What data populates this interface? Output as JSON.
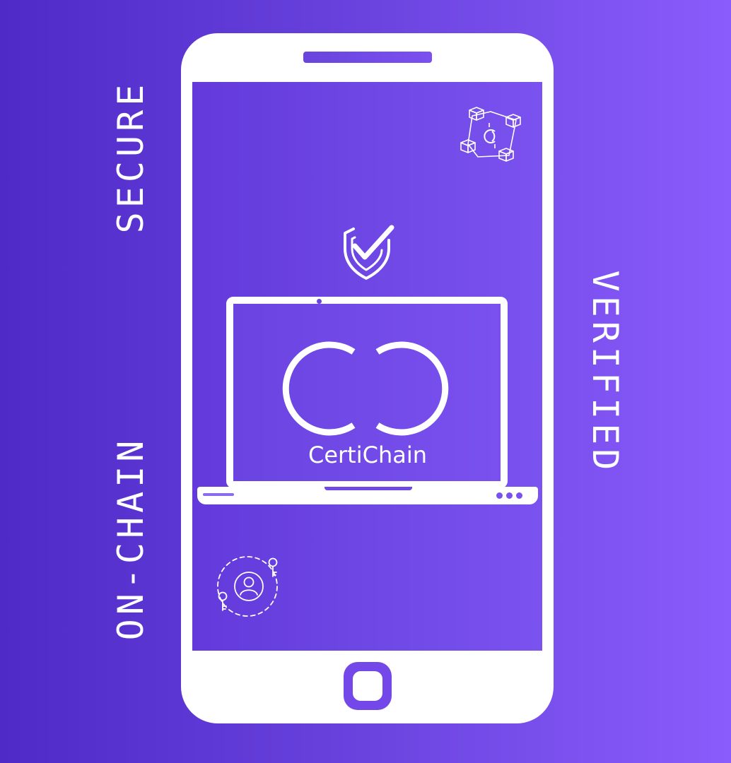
{
  "side_labels": {
    "left_top": "SECURE",
    "left_bottom": "ON-CHAIN",
    "right": "VERIFIED"
  },
  "brand": {
    "name": "CertiChain",
    "logo_text": "CC"
  },
  "icons": {
    "shield": "shield-check-icon",
    "blockchain": "blockchain-cubes-icon",
    "identity": "user-keys-icon",
    "home": "home-button-icon"
  },
  "colors": {
    "background_start": "#4f2ac6",
    "background_end": "#8a5cfb",
    "foreground": "#ffffff"
  }
}
